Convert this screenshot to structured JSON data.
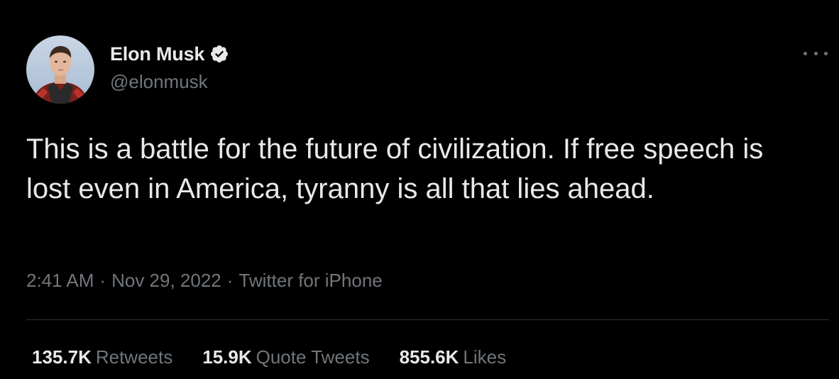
{
  "author": {
    "display_name": "Elon Musk",
    "handle": "@elonmusk",
    "verified": true,
    "avatar_icon": "profile-photo"
  },
  "tweet": {
    "text": "This is a battle for the future of civilization. If free speech is lost even in America, tyranny is all that lies ahead.",
    "time": "2:41 AM",
    "separator": "·",
    "date": "Nov 29, 2022",
    "source": "Twitter for iPhone"
  },
  "stats": {
    "retweets_count": "135.7K",
    "retweets_label": "Retweets",
    "quotes_count": "15.9K",
    "quotes_label": "Quote Tweets",
    "likes_count": "855.6K",
    "likes_label": "Likes"
  },
  "icons": {
    "more": "more-horizontal-icon",
    "verified": "verified-badge-icon"
  },
  "colors": {
    "background": "#000000",
    "primary_text": "#e7e9ea",
    "secondary_text": "#71767b",
    "divider": "#2f3336"
  }
}
